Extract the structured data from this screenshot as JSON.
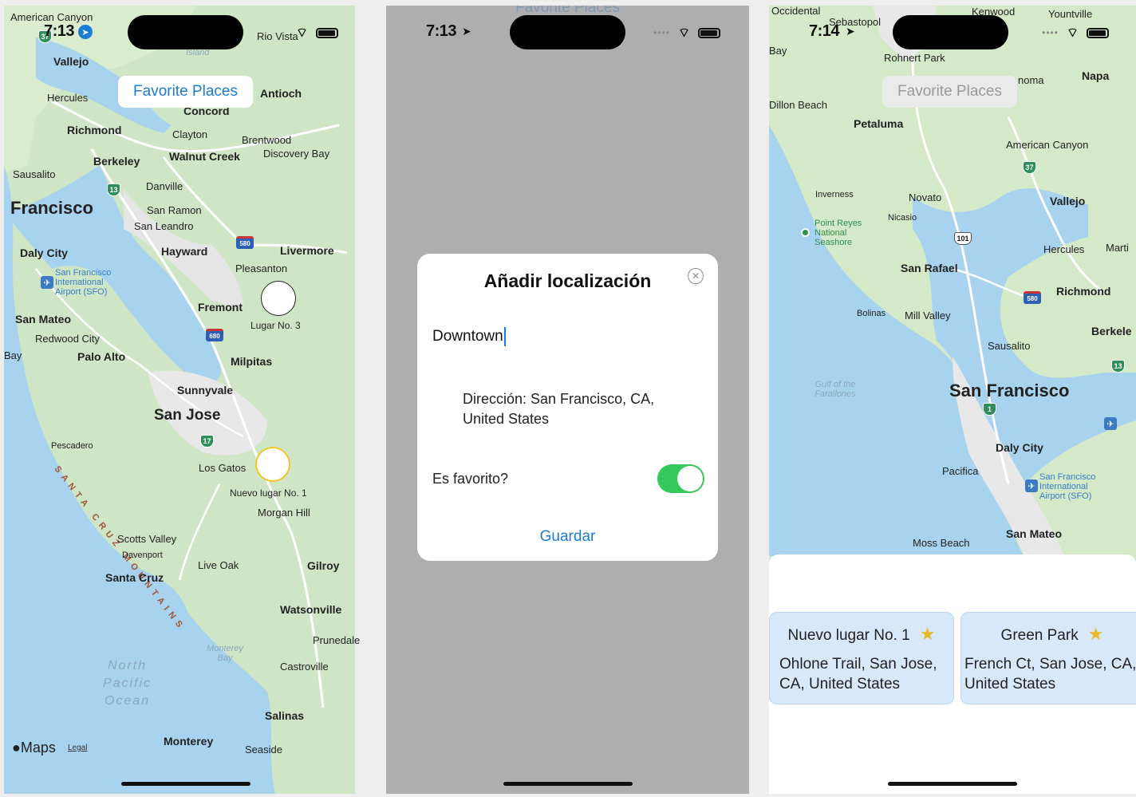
{
  "colors": {
    "accent": "#1a7cd6",
    "toggle_on": "#34c759",
    "star": "#e8b92a",
    "card_bg": "#d8e8fb"
  },
  "screen1": {
    "time": "7:13",
    "fav_button": "Favorite Places",
    "labels": {
      "american_canyon": "American Canyon",
      "rio_vista": "Rio Vista",
      "island": "Island",
      "vallejo": "Vallejo",
      "hercules": "Hercules",
      "antioch": "Antioch",
      "concord": "Concord",
      "richmond": "Richmond",
      "clayton": "Clayton",
      "brentwood": "Brentwood",
      "berkeley": "Berkeley",
      "walnut_creek": "Walnut Creek",
      "discovery_bay": "Discovery Bay",
      "sausalito": "Sausalito",
      "danville": "Danville",
      "francisco": "Francisco",
      "san_ramon": "San Ramon",
      "san_leandro": "San Leandro",
      "daly_city": "Daly City",
      "hayward": "Hayward",
      "livermore": "Livermore",
      "pleasanton": "Pleasanton",
      "sfo": "San Francisco International Airport (SFO)",
      "fremont": "Fremont",
      "san_mateo": "San Mateo",
      "redwood_city": "Redwood City",
      "palo_alto": "Palo Alto",
      "bay": "Bay",
      "milpitas": "Milpitas",
      "sunnyvale": "Sunnyvale",
      "san_jose": "San Jose",
      "pescadero": "Pescadero",
      "los_gatos": "Los Gatos",
      "morgan_hill": "Morgan Hill",
      "scotts_valley": "Scotts Valley",
      "davenport": "Davenport",
      "santa_cruz": "Santa Cruz",
      "live_oak": "Live Oak",
      "gilroy": "Gilroy",
      "watsonville": "Watsonville",
      "prunedale": "Prunedale",
      "monterey_bay": "Monterey Bay",
      "castroville": "Castroville",
      "ocean": "North Pacific Ocean",
      "salinas": "Salinas",
      "monterey": "Monterey",
      "seaside": "Seaside",
      "range": "SANTA CRUZ MOUNTAINS"
    },
    "shields": {
      "i37": "37",
      "i13": "13",
      "i580": "580",
      "i680": "680",
      "i17": "17"
    },
    "markers": [
      {
        "label": "Lugar No. 3"
      },
      {
        "label": "Nuevo lugar No. 1"
      }
    ],
    "maps_logo": "Maps",
    "legal": "Legal"
  },
  "screen2": {
    "time": "7:13",
    "top_text": "Favorite Places",
    "dialog": {
      "title": "Añadir localización",
      "name_value": "Downtown",
      "address": "Dirección: San Francisco, CA, United States",
      "fav_label": "Es favorito?",
      "save": "Guardar"
    }
  },
  "screen3": {
    "time": "7:14",
    "fav_button": "Favorite Places",
    "labels": {
      "occidental": "Occidental",
      "sebastopol": "Sebastopol",
      "kenwood": "Kenwood",
      "yountville": "Yountville",
      "bay": "Bay",
      "rohnert_park": "Rohnert Park",
      "sonoma": "noma",
      "napa": "Napa",
      "dillon_beach": "Dillon Beach",
      "petaluma": "Petaluma",
      "american_canyon": "American Canyon",
      "inverness": "Inverness",
      "novato": "Novato",
      "vallejo": "Vallejo",
      "nicasio": "Nicasio",
      "point_reyes": "Point Reyes National Seashore",
      "san_rafael": "San Rafael",
      "hercules": "Hercules",
      "martinez": "Marti",
      "richmond": "Richmond",
      "bolinas": "Bolinas",
      "mill_valley": "Mill Valley",
      "berkeley": "Berkele",
      "sausalito": "Sausalito",
      "gulf": "Gulf of the Farallones",
      "san_francisco": "San Francisco",
      "daly_city": "Daly City",
      "pacifica": "Pacifica",
      "sfo": "San Francisco International Airport (SFO)",
      "san_mateo": "San Mateo",
      "moss_beach": "Moss Beach"
    },
    "shields": {
      "i37": "37",
      "i101": "101",
      "i580": "580",
      "i13": "13",
      "i1": "1"
    },
    "cards": [
      {
        "name": "Nuevo lugar No. 1",
        "address": "Ohlone Trail, San Jose, CA, United States"
      },
      {
        "name": "Green Park",
        "address": "French Ct, San Jose, CA, United States"
      }
    ]
  }
}
